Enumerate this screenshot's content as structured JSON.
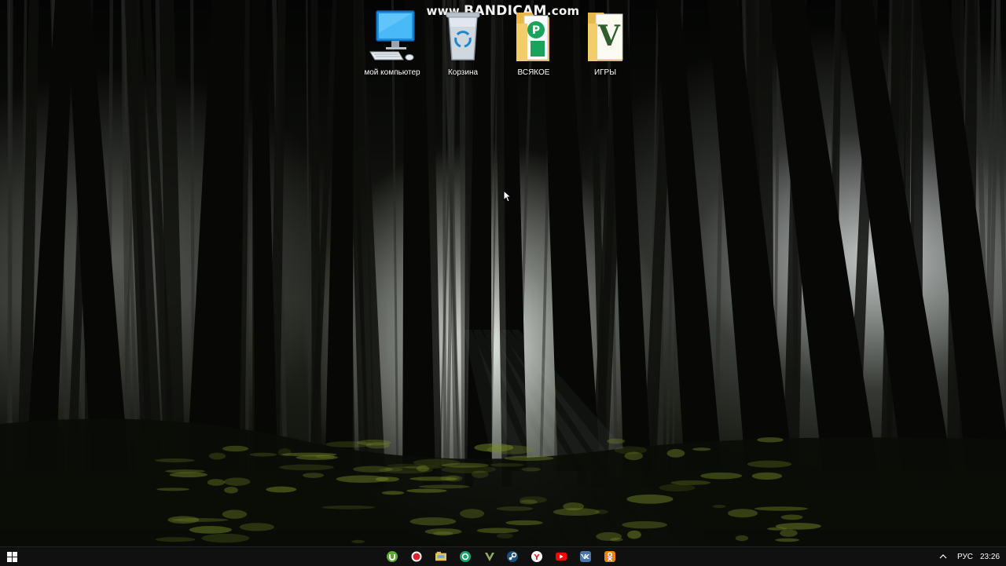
{
  "watermark": {
    "prefix": "www.",
    "brand": "BANDICAM",
    "suffix": ".com"
  },
  "desktop": {
    "icons": [
      {
        "label": "мой компьютер",
        "icon": "computer-icon"
      },
      {
        "label": "Корзина",
        "icon": "recycle-bin-icon"
      },
      {
        "label": "ВСЯКОЕ",
        "icon": "folder-icon"
      },
      {
        "label": "ИГРЫ",
        "icon": "folder-icon"
      }
    ]
  },
  "taskbar": {
    "start_icon": "windows-icon",
    "apps": [
      {
        "icon": "utorrent-icon",
        "color": "#5aab2d"
      },
      {
        "icon": "bandicam-icon",
        "color": "#e0202a"
      },
      {
        "icon": "explorer-icon",
        "color": "#e8c35a"
      },
      {
        "icon": "kaspersky-icon",
        "color": "#1aa46b"
      },
      {
        "icon": "gta-v-icon",
        "color": "#6f8b48"
      },
      {
        "icon": "steam-icon",
        "color": "#2a6fa8"
      },
      {
        "icon": "yandex-browser-icon",
        "color": "#e52620"
      },
      {
        "icon": "youtube-icon",
        "color": "#ff0000"
      },
      {
        "icon": "vk-icon",
        "color": "#4a76a8"
      },
      {
        "icon": "odnoklassniki-icon",
        "color": "#ee8208"
      }
    ],
    "tray": {
      "chevron_icon": "chevron-up-icon",
      "language": "РУС",
      "time": "23:26"
    }
  }
}
